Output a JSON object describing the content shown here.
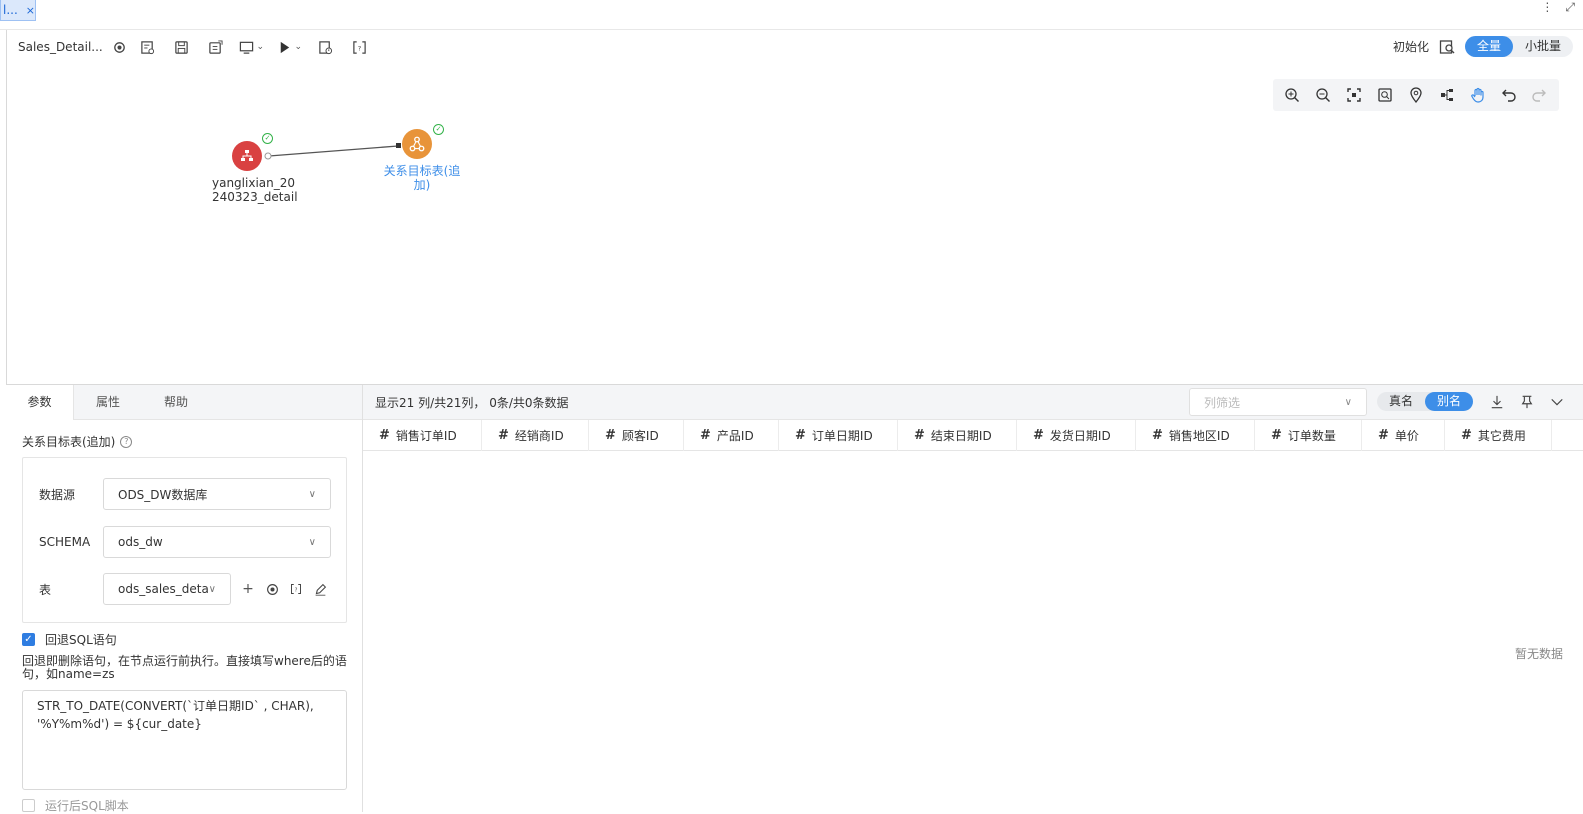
{
  "tab": {
    "label": "l...",
    "close": "×"
  },
  "window_controls": {
    "more": "⋮",
    "expand": "⤢"
  },
  "toolbar": {
    "flow_name": "Sales_Detail...",
    "icons": [
      "target-icon",
      "form-icon",
      "save-icon",
      "save-as-icon",
      "monitor-icon",
      "run-icon",
      "schedule-icon",
      "bracket-icon"
    ]
  },
  "header_right": {
    "init_label": "初始化",
    "mode_full": "全量",
    "mode_batch": "小批量"
  },
  "nodes": {
    "source": {
      "label_line1": "yanglixian_20",
      "label_line2": "240323_detail",
      "color": "#d94141"
    },
    "target": {
      "label_line1": "关系目标表(追",
      "label_line2": "加)",
      "color": "#e8943a",
      "label_color": "#3d8ee8"
    }
  },
  "left_panel": {
    "tabs": [
      "参数",
      "属性",
      "帮助"
    ],
    "section_title": "关系目标表(追加)",
    "fields": {
      "datasource_label": "数据源",
      "datasource_value": "ODS_DW数据库",
      "schema_label": "SCHEMA",
      "schema_value": "ods_dw",
      "table_label": "表",
      "table_value": "ods_sales_detail"
    },
    "rollback_label": "回退SQL语句",
    "rollback_desc": "回退即删除语句，在节点运行前执行。直接填写where后的语句，如name=zs",
    "sql_text": "STR_TO_DATE(CONVERT(`订单日期ID` , CHAR),\n'%Y%m%d') = ${cur_date}",
    "post_sql_label": "运行后SQL脚本"
  },
  "right_panel": {
    "summary": "显示21 列/共21列， 0条/共0条数据",
    "column_filter_placeholder": "列筛选",
    "name_real": "真名",
    "name_alias": "别名",
    "columns": [
      "销售订单ID",
      "经销商ID",
      "顾客ID",
      "产品ID",
      "订单日期ID",
      "结束日期ID",
      "发货日期ID",
      "销售地区ID",
      "订单数量",
      "单价",
      "其它费用"
    ],
    "no_data": "暂无数据"
  }
}
